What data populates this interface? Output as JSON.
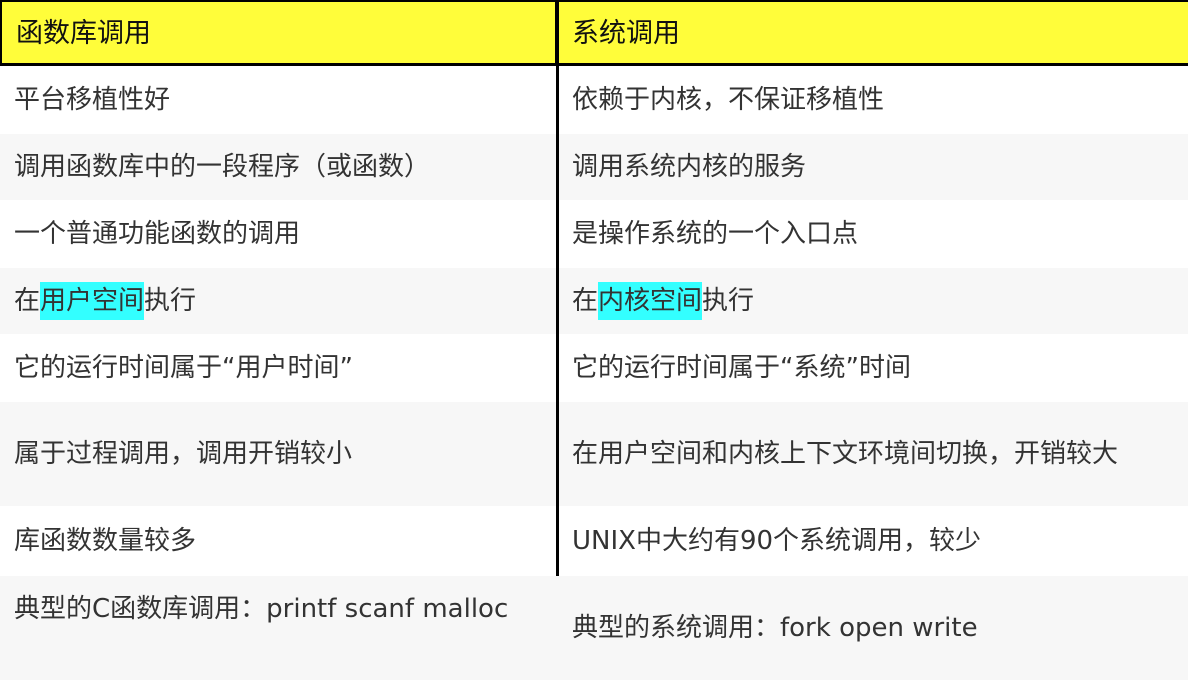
{
  "colors": {
    "header_bg": "#fffd3a",
    "row_light": "#ffffff",
    "row_shade": "#f7f7f7",
    "highlight": "#33ffff"
  },
  "header": {
    "col1": "函数库调用",
    "col2": "系统调用"
  },
  "rows": [
    {
      "left": "平台移植性好",
      "right": "依赖于内核，不保证移植性"
    },
    {
      "left": "调用函数库中的一段程序（或函数）",
      "right": "调用系统内核的服务"
    },
    {
      "left": "一个普通功能函数的调用",
      "right": "是操作系统的一个入口点"
    },
    {
      "left_pre": "在",
      "left_hl": "用户空间",
      "left_post": "执行",
      "right_pre": "在",
      "right_hl": "内核空间",
      "right_post": "执行"
    },
    {
      "left": "它的运行时间属于“用户时间”",
      "right": "它的运行时间属于“系统”时间"
    },
    {
      "left": "属于过程调用，调用开销较小",
      "right": "在用户空间和内核上下文环境间切换，开销较大"
    },
    {
      "left": "库函数数量较多",
      "right": "UNIX中大约有90个系统调用，较少"
    },
    {
      "left": "典型的C函数库调用：printf scanf malloc",
      "right": "典型的系统调用：fork open write"
    }
  ]
}
